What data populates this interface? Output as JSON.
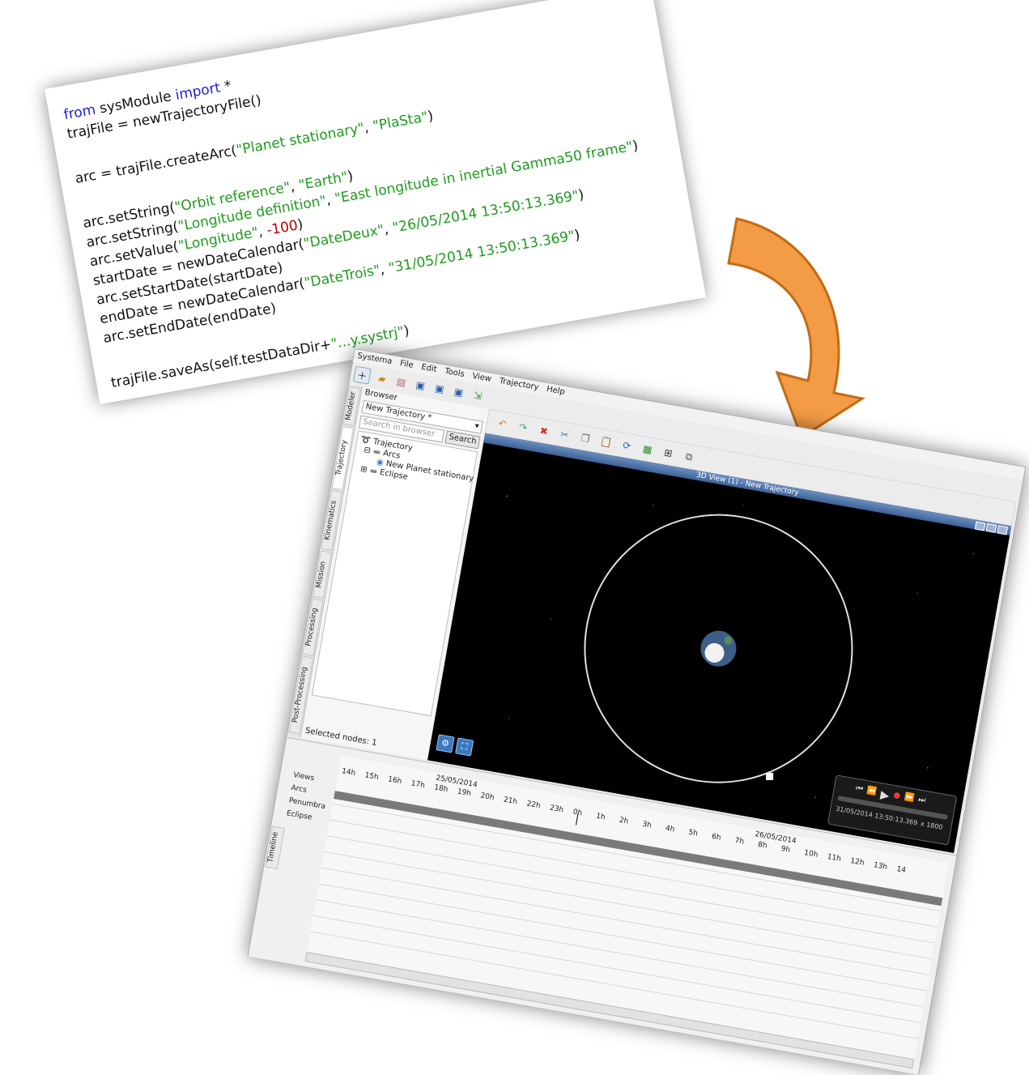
{
  "code": {
    "lines": [
      [
        {
          "t": "from ",
          "c": "kw"
        },
        {
          "t": "sysModule "
        },
        {
          "t": "import",
          "c": "kw"
        },
        {
          "t": " *"
        }
      ],
      [
        {
          "t": "trajFile = newTrajectoryFile()"
        }
      ],
      [],
      [
        {
          "t": "arc = trajFile.createArc("
        },
        {
          "t": "\"Planet stationary\"",
          "c": "str"
        },
        {
          "t": ", "
        },
        {
          "t": "\"PlaSta\"",
          "c": "str"
        },
        {
          "t": ")"
        }
      ],
      [],
      [
        {
          "t": "arc.setString("
        },
        {
          "t": "\"Orbit reference\"",
          "c": "str"
        },
        {
          "t": ", "
        },
        {
          "t": "\"Earth\"",
          "c": "str"
        },
        {
          "t": ")"
        }
      ],
      [
        {
          "t": "arc.setString("
        },
        {
          "t": "\"Longitude definition\"",
          "c": "str"
        },
        {
          "t": ", "
        },
        {
          "t": "\"East longitude in inertial Gamma50 frame\"",
          "c": "str"
        },
        {
          "t": ")"
        }
      ],
      [
        {
          "t": "arc.setValue("
        },
        {
          "t": "\"Longitude\"",
          "c": "str"
        },
        {
          "t": ", "
        },
        {
          "t": "-100",
          "c": "num"
        },
        {
          "t": ")"
        }
      ],
      [
        {
          "t": "startDate = newDateCalendar("
        },
        {
          "t": "\"DateDeux\"",
          "c": "str"
        },
        {
          "t": ", "
        },
        {
          "t": "\"26/05/2014 13:50:13.369\"",
          "c": "str"
        },
        {
          "t": ")"
        }
      ],
      [
        {
          "t": "arc.setStartDate(startDate)"
        }
      ],
      [
        {
          "t": "endDate = newDateCalendar("
        },
        {
          "t": "\"DateTrois\"",
          "c": "str"
        },
        {
          "t": ", "
        },
        {
          "t": "\"31/05/2014 13:50:13.369\"",
          "c": "str"
        },
        {
          "t": ")"
        }
      ],
      [
        {
          "t": "arc.setEndDate(endDate)"
        }
      ],
      [],
      [
        {
          "t": "trajFile.saveAs(self.testDataDir+"
        },
        {
          "t": "\"...y.systrj\"",
          "c": "str"
        },
        {
          "t": ")"
        }
      ]
    ]
  },
  "menu": [
    "Systema",
    "File",
    "Edit",
    "Tools",
    "View",
    "Trajectory",
    "Help"
  ],
  "side_tabs": [
    "Modeler",
    "Trajectory",
    "Kinematics",
    "Mission",
    "Processing",
    "Post-Processing"
  ],
  "browser": {
    "title": "Browser",
    "combo_value": "New Trajectory *",
    "search_placeholder": "Search in browser",
    "search_button": "Search",
    "tree": [
      "Trajectory",
      "Arcs",
      "New Planet stationary",
      "Eclipse"
    ],
    "selected_nodes": "Selected nodes: 1"
  },
  "view": {
    "title": "3D View (1) - New Trajectory"
  },
  "player": {
    "date": "31/05/2014 13:50:13.369",
    "speed": "x 1800"
  },
  "timeline": {
    "tab": "Timeline",
    "rows": [
      "Views",
      "Arcs",
      "Penumbra",
      "Eclipse"
    ],
    "ticks": [
      "14h",
      "15h",
      "16h",
      "17h",
      "18h",
      "19h",
      "20h",
      "21h",
      "22h",
      "23h",
      "0h",
      "1h",
      "2h",
      "3h",
      "4h",
      "5h",
      "6h",
      "7h",
      "8h",
      "9h",
      "10h",
      "11h",
      "12h",
      "13h",
      "14"
    ],
    "date1": "25/05/2014",
    "date2": "26/05/2014"
  },
  "colors": {
    "arrow": "#f39c45",
    "keyword": "#1d1dd8",
    "string": "#1e9b1e",
    "number": "#b30000"
  }
}
